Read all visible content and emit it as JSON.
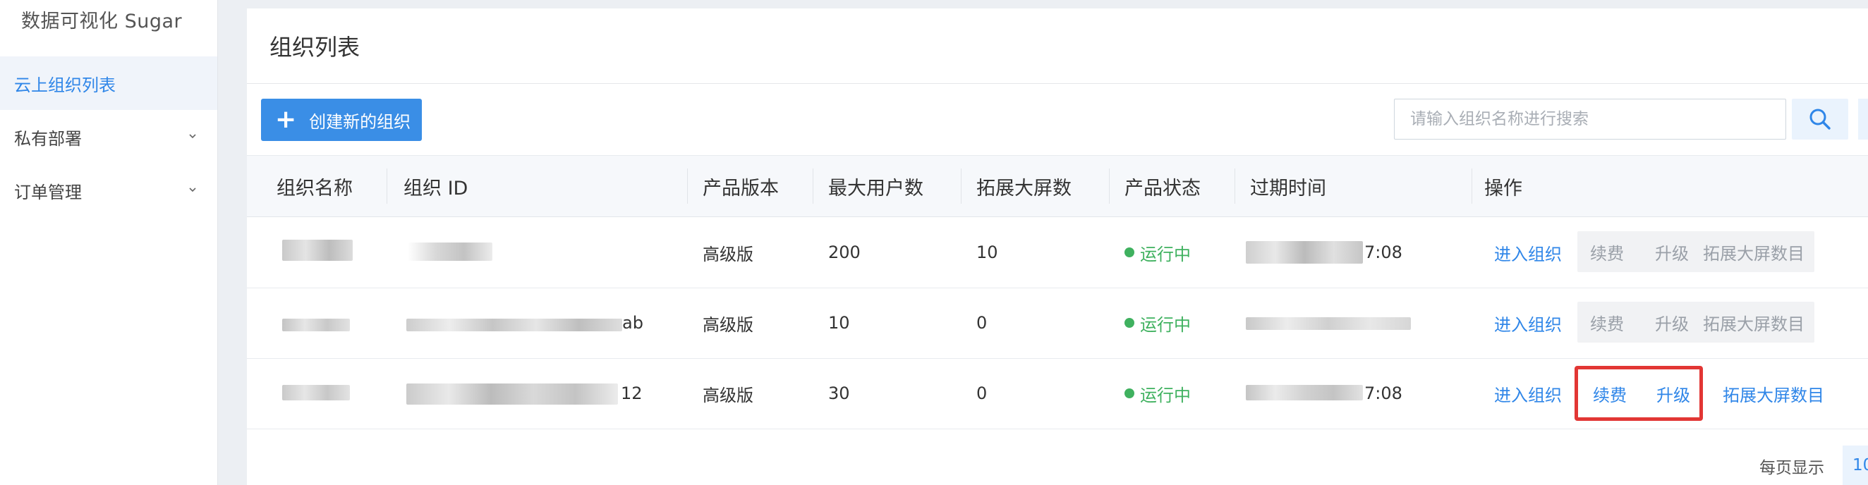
{
  "sidebar": {
    "brand": "数据可视化 Sugar",
    "items": [
      {
        "label": "云上组织列表"
      },
      {
        "label": "私有部署"
      },
      {
        "label": "订单管理"
      }
    ]
  },
  "main": {
    "title": "组织列表",
    "create_button": "创建新的组织",
    "search": {
      "placeholder": "请输入组织名称进行搜索"
    },
    "table": {
      "headers": [
        "组织名称",
        "组织 ID",
        "产品版本",
        "最大用户数",
        "拓展大屏数",
        "产品状态",
        "过期时间",
        "操作"
      ],
      "rows": [
        {
          "name": "",
          "id": "",
          "version": "高级版",
          "max_users": "200",
          "screens": "10",
          "status": "运行中",
          "expire": "7:08",
          "ops": {
            "enter": "进入组织",
            "renew": "续费",
            "upgrade": "升级",
            "expand": "拓展大屏数目"
          }
        },
        {
          "name": "",
          "id": "ab",
          "version": "高级版",
          "max_users": "10",
          "screens": "0",
          "status": "运行中",
          "expire": "",
          "ops": {
            "enter": "进入组织",
            "renew": "续费",
            "upgrade": "升级",
            "expand": "拓展大屏数目"
          }
        },
        {
          "name": "",
          "id": "12",
          "version": "高级版",
          "max_users": "30",
          "screens": "0",
          "status": "运行中",
          "expire": "7:08",
          "ops": {
            "enter": "进入组织",
            "renew": "续费",
            "upgrade": "升级",
            "expand": "拓展大屏数目"
          }
        }
      ]
    },
    "pagination": {
      "label": "每页显示",
      "value": "10"
    }
  },
  "colors": {
    "accent": "#3a8ee6",
    "link": "#2f86e8",
    "status_running": "#3fb15f",
    "highlight": "#e23634"
  },
  "icons": [
    "plus-icon",
    "search-icon",
    "chevron-down-icon"
  ]
}
